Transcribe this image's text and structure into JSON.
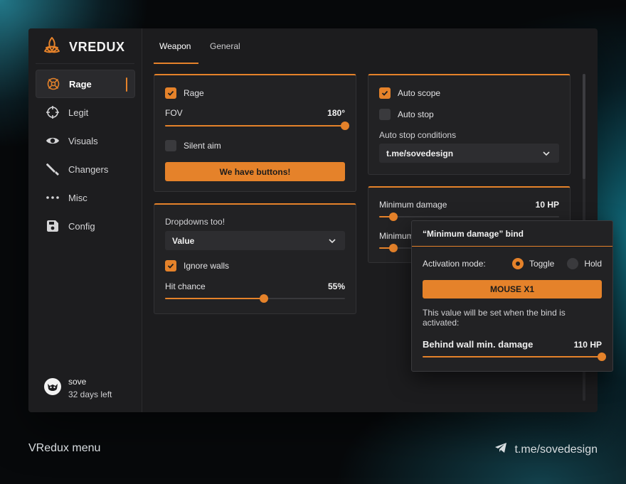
{
  "app": {
    "name": "VREDUX"
  },
  "sidebar": {
    "items": [
      {
        "label": "Rage",
        "icon": "rage-icon",
        "active": true
      },
      {
        "label": "Legit",
        "icon": "crosshair-icon"
      },
      {
        "label": "Visuals",
        "icon": "eye-icon"
      },
      {
        "label": "Changers",
        "icon": "knife-icon"
      },
      {
        "label": "Misc",
        "icon": "dots-icon"
      },
      {
        "label": "Config",
        "icon": "save-icon"
      }
    ],
    "user": {
      "name": "sove",
      "status": "32 days left"
    }
  },
  "tabs": [
    {
      "label": "Weapon",
      "active": true
    },
    {
      "label": "General"
    }
  ],
  "rage_card": {
    "rage_label": "Rage",
    "rage_checked": true,
    "fov_label": "FOV",
    "fov_value": "180°",
    "fov_fraction": 1.0,
    "silent_aim_label": "Silent aim",
    "silent_aim_checked": false,
    "button_label": "We have buttons!"
  },
  "dropdown_card": {
    "title": "Dropdowns too!",
    "select_value": "Value",
    "ignore_walls_label": "Ignore walls",
    "ignore_walls_checked": true,
    "hit_chance_label": "Hit chance",
    "hit_chance_value": "55%",
    "hit_chance_fraction": 0.55
  },
  "scope_card": {
    "auto_scope_label": "Auto scope",
    "auto_scope_checked": true,
    "auto_stop_label": "Auto stop",
    "auto_stop_checked": false,
    "conditions_label": "Auto stop conditions",
    "conditions_value": "t.me/sovedesign"
  },
  "damage_card": {
    "min_damage_label": "Minimum damage",
    "min_damage_value": "10 HP",
    "min_damage_fraction": 0.08,
    "second_label": "Minimum",
    "second_fraction": 0.08
  },
  "bind_popup": {
    "title": "“Minimum damage” bind",
    "mode_label": "Activation mode:",
    "toggle_label": "Toggle",
    "hold_label": "Hold",
    "selected_mode": "Toggle",
    "key_label": "MOUSE X1",
    "note": "This value will be set when the bind is activated:",
    "behind_wall_label": "Behind wall min. damage",
    "behind_wall_value": "110 HP",
    "behind_wall_fraction": 1.0
  },
  "footer": {
    "left": "VRedux menu",
    "right": "t.me/sovedesign"
  },
  "colors": {
    "accent": "#e5822a",
    "panel": "#222224",
    "background": "#1c1c1e"
  }
}
